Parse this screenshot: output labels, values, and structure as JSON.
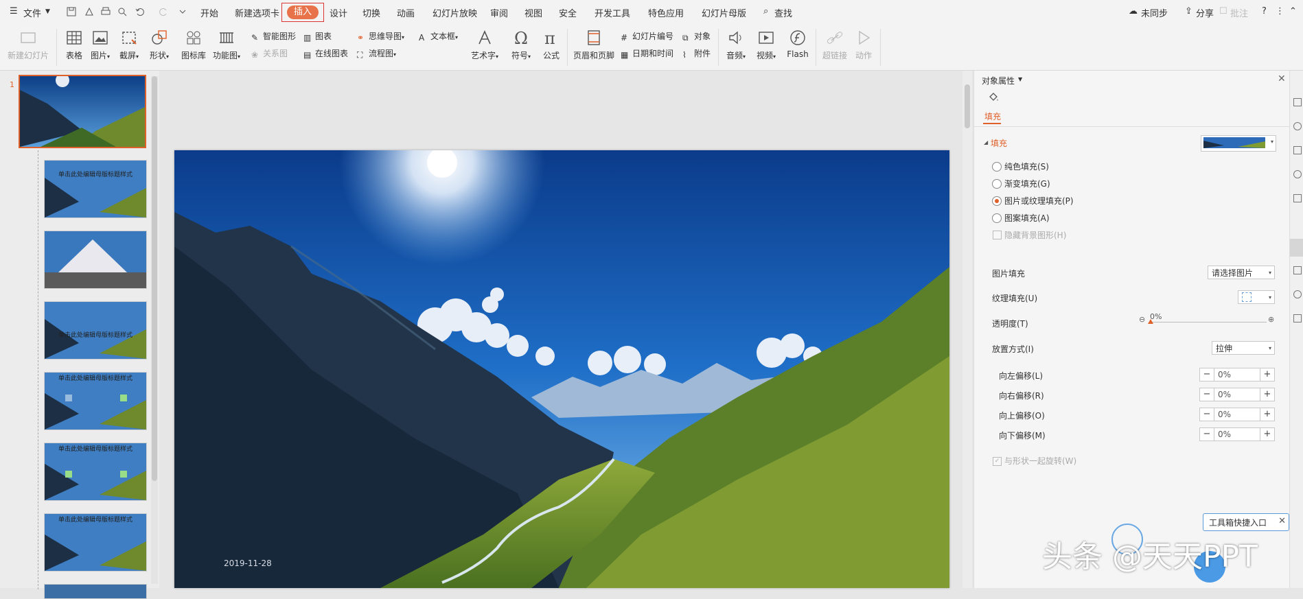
{
  "menubar": {
    "file_label": "文件",
    "tabs": [
      "开始",
      "新建选项卡",
      "插入",
      "设计",
      "切换",
      "动画",
      "幻灯片放映",
      "审阅",
      "视图",
      "安全",
      "开发工具",
      "特色应用",
      "幻灯片母版"
    ],
    "active_tab": "插入",
    "search_label": "查找",
    "sync_label": "未同步",
    "share_label": "分享",
    "comment_label": "批注",
    "help_label": "?"
  },
  "ribbon": {
    "new_slide": "新建幻灯片",
    "table": "表格",
    "picture": "图片",
    "screenshot": "截屏",
    "shape": "形状",
    "icon_lib": "图标库",
    "func_chart": "功能图",
    "smart_art": "智能图形",
    "chart": "图表",
    "relation": "关系图",
    "online_chart": "在线图表",
    "mind_map": "思维导图",
    "flow_chart": "流程图",
    "text_box": "文本框",
    "art_text": "艺术字",
    "symbol": "符号",
    "formula": "公式",
    "header_footer": "页眉和页脚",
    "slide_number": "幻灯片编号",
    "object": "对象",
    "date_time": "日期和时间",
    "attachment": "附件",
    "audio": "音频",
    "video": "视频",
    "flash": "Flash",
    "hyperlink": "超链接",
    "action": "动作"
  },
  "thumbnails": {
    "current_number": "1",
    "title_text": "单击此处编辑母版标题样式"
  },
  "slide": {
    "date": "2019-11-28"
  },
  "panel": {
    "title": "对象属性",
    "tab_fill": "填充",
    "section_fill": "填充",
    "radio_solid": "纯色填充(S)",
    "radio_gradient": "渐变填充(G)",
    "radio_picture": "图片或纹理填充(P)",
    "radio_pattern": "图案填充(A)",
    "hide_bg": "隐藏背景图形(H)",
    "pic_fill_label": "图片填充",
    "pic_fill_value": "请选择图片",
    "texture_label": "纹理填充(U)",
    "transparency_label": "透明度(T)",
    "transparency_value": "0%",
    "placement_label": "放置方式(I)",
    "placement_value": "拉伸",
    "offset_left_label": "向左偏移(L)",
    "offset_right_label": "向右偏移(R)",
    "offset_up_label": "向上偏移(O)",
    "offset_down_label": "向下偏移(M)",
    "offset_left": "0%",
    "offset_right": "0%",
    "offset_up": "0%",
    "offset_down": "0%",
    "rotate_with_shape": "与形状一起旋转(W)"
  },
  "toolbox_tip": "工具箱快捷入口",
  "watermark": "头条 @天天PPT",
  "colors": {
    "accent": "#e0602a",
    "active_tab_bg": "#e8734a"
  }
}
